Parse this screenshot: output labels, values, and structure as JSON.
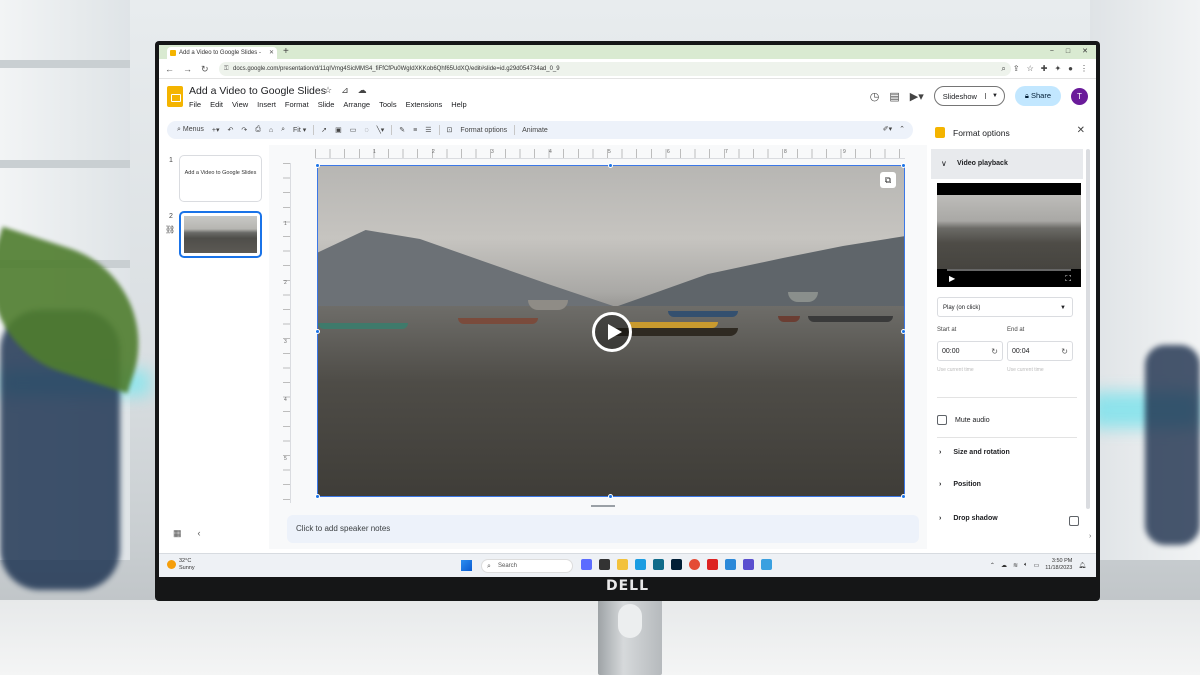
{
  "browser": {
    "tab_title": "Add a Video to Google Slides -",
    "url": "docs.google.com/presentation/d/11qIVmg4SicMMS4_fiFfCfPu0WgIdXKKob6Qhf65UdXQ/edit#slide=id.g29d054734ad_0_9"
  },
  "app": {
    "title": "Add a Video to Google Slides",
    "menu": [
      "File",
      "Edit",
      "View",
      "Insert",
      "Format",
      "Slide",
      "Arrange",
      "Tools",
      "Extensions",
      "Help"
    ],
    "slideshow_label": "Slideshow",
    "share_label": "Share",
    "avatar_letter": "T"
  },
  "toolbar": {
    "menus_label": "Menus",
    "zoom_label": "Fit",
    "format_options_label": "Format options",
    "animate_label": "Animate"
  },
  "filmstrip": {
    "slides": [
      {
        "number": "1",
        "text": "Add a Video to Google Slides"
      },
      {
        "number": "2",
        "text": ""
      }
    ]
  },
  "ruler": {
    "h_ticks": [
      "1",
      "2",
      "3",
      "4",
      "5",
      "6",
      "7",
      "8",
      "9"
    ],
    "v_ticks": [
      "1",
      "2",
      "3",
      "4",
      "5"
    ]
  },
  "notes": {
    "placeholder": "Click to add speaker notes"
  },
  "panel": {
    "title": "Format options",
    "video_playback_label": "Video playback",
    "play_mode": "Play (on click)",
    "start_label": "Start at",
    "end_label": "End at",
    "start_value": "00:00",
    "end_value": "00:04",
    "use_current_label": "Use current time",
    "mute_label": "Mute audio",
    "size_rotation_label": "Size and rotation",
    "position_label": "Position",
    "drop_shadow_label": "Drop shadow"
  },
  "taskbar": {
    "temperature": "32°C",
    "weather": "Sunny",
    "search_label": "Search",
    "time": "3:50 PM",
    "date": "11/18/2023"
  },
  "monitor": {
    "brand": "DELL"
  },
  "colors": {
    "accent_blue": "#1a73e8",
    "share_bg": "#c2e7ff",
    "slides_yellow": "#f4b400",
    "tab_green": "#d9ead1"
  }
}
